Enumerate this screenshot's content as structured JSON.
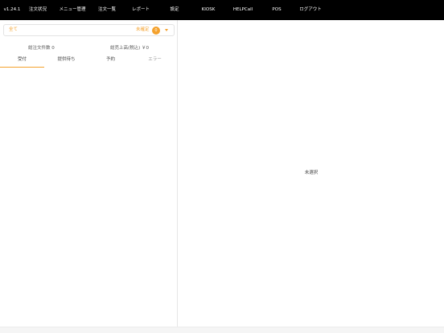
{
  "header": {
    "version": "v1.24.1",
    "nav": [
      "注文状況",
      "メニュー管理",
      "注文一覧",
      "レポート",
      "設定",
      "KIOSK",
      "HELPCall",
      "POS",
      "ログアウト"
    ]
  },
  "filter": {
    "all_label": "全て",
    "unconfirmed_label": "未確定",
    "unconfirmed_count": "0",
    "icon": "chevron-down-icon"
  },
  "stats": {
    "order_count": "総注文件数 0",
    "sales": "総売上高(税込) ￥0"
  },
  "tabs": [
    "受付",
    "提供待ち",
    "予約",
    "エラー"
  ],
  "detail": {
    "empty_text": "未選択"
  },
  "colors": {
    "accent": "#f4a12c",
    "header_bg": "#000000"
  }
}
